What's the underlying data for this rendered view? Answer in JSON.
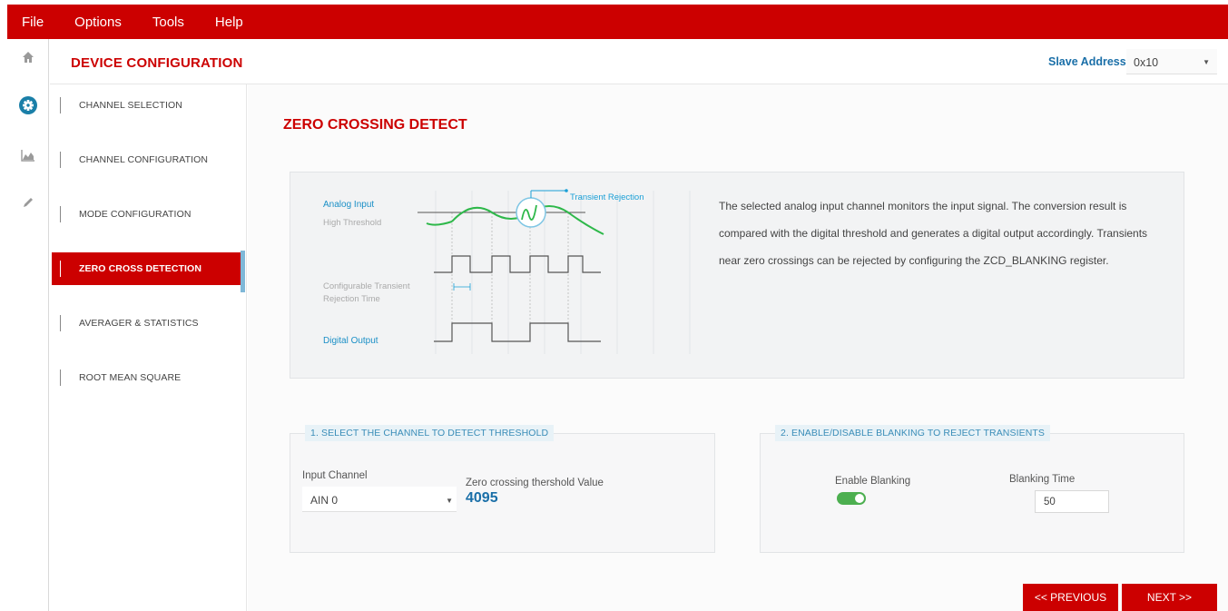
{
  "menu": {
    "items": [
      "File",
      "Options",
      "Tools",
      "Help"
    ]
  },
  "rail": {
    "icons": [
      "home-icon",
      "gear-icon",
      "chart-icon",
      "pencil-icon"
    ]
  },
  "header": {
    "title": "DEVICE CONFIGURATION",
    "slave_address_label": "Slave Address:",
    "slave_address_value": "0x10"
  },
  "nav": {
    "items": [
      {
        "label": "CHANNEL SELECTION",
        "active": false
      },
      {
        "label": "CHANNEL CONFIGURATION",
        "active": false
      },
      {
        "label": "MODE CONFIGURATION",
        "active": false
      },
      {
        "label": "ZERO CROSS DETECTION",
        "active": true
      },
      {
        "label": "AVERAGER & STATISTICS",
        "active": false
      },
      {
        "label": "ROOT MEAN SQUARE",
        "active": false
      }
    ]
  },
  "main": {
    "title": "ZERO CROSSING DETECT",
    "diagram": {
      "analog_input": "Analog Input",
      "high_threshold": "High Threshold",
      "transient_rejection": "Transient Rejection",
      "configurable_line1": "Configurable Transient",
      "configurable_line2": "Rejection Time",
      "digital_output": "Digital Output"
    },
    "description": "The selected analog input channel monitors the input signal. The conversion result is compared with the digital threshold and generates a digital output accordingly. Transients near zero crossings can be rejected by configuring the ZCD_BLANKING register."
  },
  "panel1": {
    "legend": "1. SELECT THE CHANNEL TO DETECT THRESHOLD",
    "input_channel_label": "Input Channel",
    "input_channel_value": "AIN 0",
    "threshold_label": "Zero crossing thershold Value",
    "threshold_value": "4095"
  },
  "panel2": {
    "legend": "2. ENABLE/DISABLE BLANKING TO REJECT TRANSIENTS",
    "enable_label": "Enable Blanking",
    "enable_on": true,
    "blanking_time_label": "Blanking Time",
    "blanking_time_value": "50"
  },
  "footer": {
    "previous_label": "<< PREVIOUS",
    "next_label": "NEXT >>"
  },
  "colors": {
    "brand_red": "#cc0000",
    "accent_blue": "#1a6fa8",
    "wave_green": "#2eb84a",
    "toggle_green": "#4caf50"
  }
}
